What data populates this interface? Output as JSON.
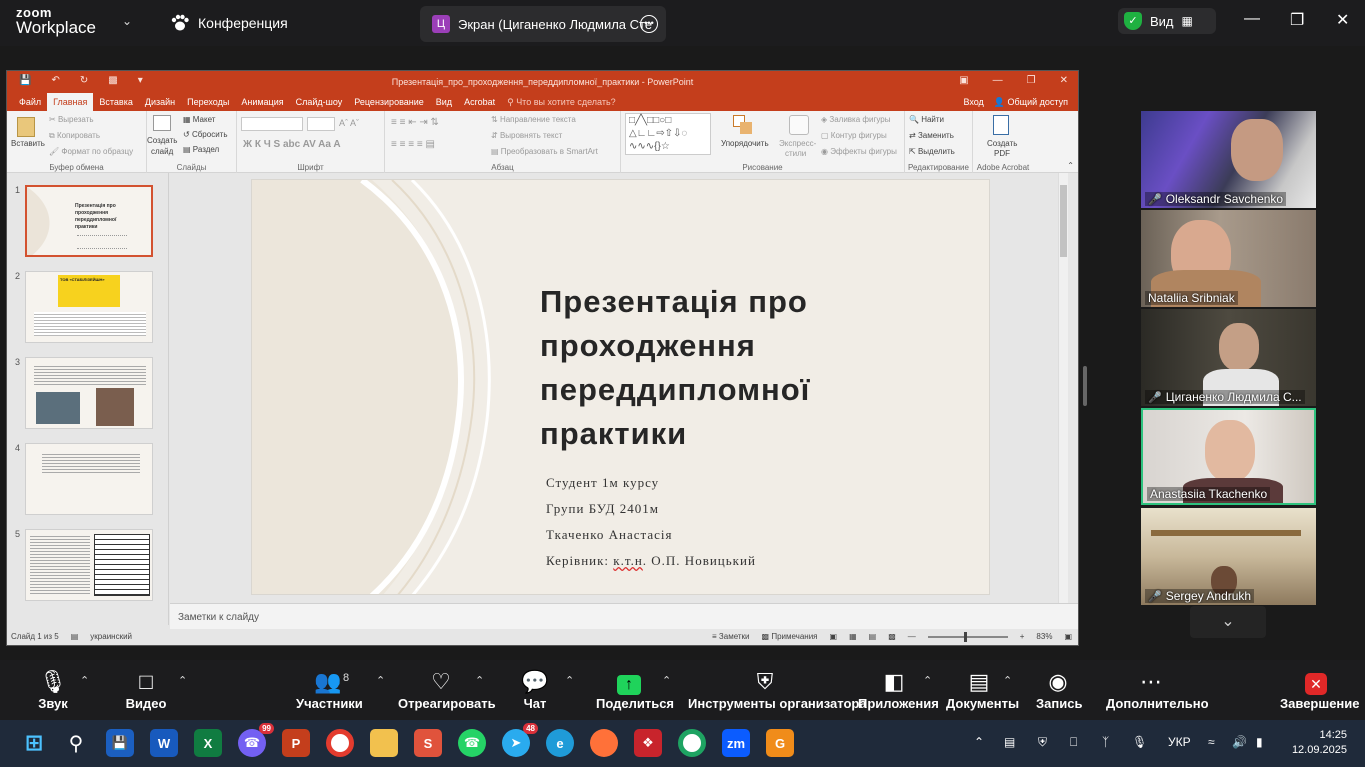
{
  "zoom_top": {
    "logo_line1": "zoom",
    "logo_line2": "Workplace",
    "conference": "Конференция",
    "screen_tab": "Экран (Циганенко Людмила Сте",
    "screen_tab_avatar": "Ц",
    "view_label": "Вид"
  },
  "ppt": {
    "window_title": "Презентація_про_проходження_переддипломної_практики - PowerPoint",
    "menu": [
      "Файл",
      "Главная",
      "Вставка",
      "Дизайн",
      "Переходы",
      "Анимация",
      "Слайд-шоу",
      "Рецензирование",
      "Вид",
      "Acrobat"
    ],
    "tell_me": "Что вы хотите сделать?",
    "signin": "Вход",
    "share": "Общий доступ",
    "ribbon": {
      "paste": "Вставить",
      "cut": "Вырезать",
      "copy": "Копировать",
      "format_painter": "Формат по образцу",
      "clipboard_group": "Буфер обмена",
      "create_slide": "Создать",
      "create_slide_2": "слайд",
      "layout": "Макет",
      "reset": "Сбросить",
      "section": "Раздел",
      "slides_group": "Слайды",
      "font_group": "Шрифт",
      "text_direction": "Направление текста",
      "align_text": "Выровнять текст",
      "smartart": "Преобразовать в SmartArt",
      "paragraph_group": "Абзац",
      "arrange": "Упорядочить",
      "express_styles": "Экспресс-",
      "express_styles_2": "стили",
      "shape_fill": "Заливка фигуры",
      "shape_outline": "Контур фигуры",
      "shape_effects": "Эффекты фигуры",
      "drawing_group": "Рисование",
      "find": "Найти",
      "replace": "Заменить",
      "select": "Выделить",
      "editing_group": "Редактирование",
      "create_pdf": "Создать",
      "create_pdf_2": "PDF",
      "acrobat_group": "Adobe Acrobat"
    },
    "thumbnails": [
      {
        "num": "1",
        "title": "Презентація про проходження переддипломної практики"
      },
      {
        "num": "2",
        "title": "ТОВ «СТАБІЛІЗЕЙШН»"
      },
      {
        "num": "3",
        "title": ""
      },
      {
        "num": "4",
        "title": ""
      },
      {
        "num": "5",
        "title": ""
      }
    ],
    "slide": {
      "title_lines": [
        "Презентація про",
        "проходження",
        "переддипломної",
        "практики"
      ],
      "meta": [
        "Студент 1м курсу",
        "Групи БУД 2401м",
        "Ткаченко Анастасія"
      ],
      "supervisor_prefix": "Керівник: ",
      "supervisor_degree": "к.т.н",
      "supervisor_rest": ". О.П. Новицький"
    },
    "notes_placeholder": "Заметки к слайду",
    "status": {
      "slide_counter": "Слайд 1 из 5",
      "language": "украинский",
      "notes": "Заметки",
      "comments": "Примечания",
      "zoom": "83%"
    }
  },
  "participants": [
    {
      "name": "Oleksandr Savchenko",
      "muted": true,
      "active": false
    },
    {
      "name": "Nataliia Sribniak",
      "muted": false,
      "active": false
    },
    {
      "name": "Циганенко Людмила С...",
      "muted": true,
      "active": false
    },
    {
      "name": "Anastasiia Tkachenko",
      "muted": false,
      "active": true
    },
    {
      "name": "Sergey Andrukh",
      "muted": true,
      "active": false
    }
  ],
  "toolbar": {
    "audio": "Звук",
    "video": "Видео",
    "participants": "Участники",
    "participants_count": "8",
    "react": "Отреагировать",
    "chat": "Чат",
    "share": "Поделиться",
    "host_tools": "Инструменты организатора",
    "apps": "Приложения",
    "docs": "Документы",
    "record": "Запись",
    "more": "Дополнительно",
    "end": "Завершение"
  },
  "taskbar": {
    "viber_badge": "99",
    "telegram_badge": "48",
    "language": "УКР",
    "time": "14:25",
    "date": "12.09.2025"
  },
  "colors": {
    "ppt_accent": "#c43e1c",
    "zoom_bg": "#1c1c1e",
    "share_green": "#1fd35b",
    "end_red": "#e02828",
    "active_speaker": "#2ec27e"
  }
}
